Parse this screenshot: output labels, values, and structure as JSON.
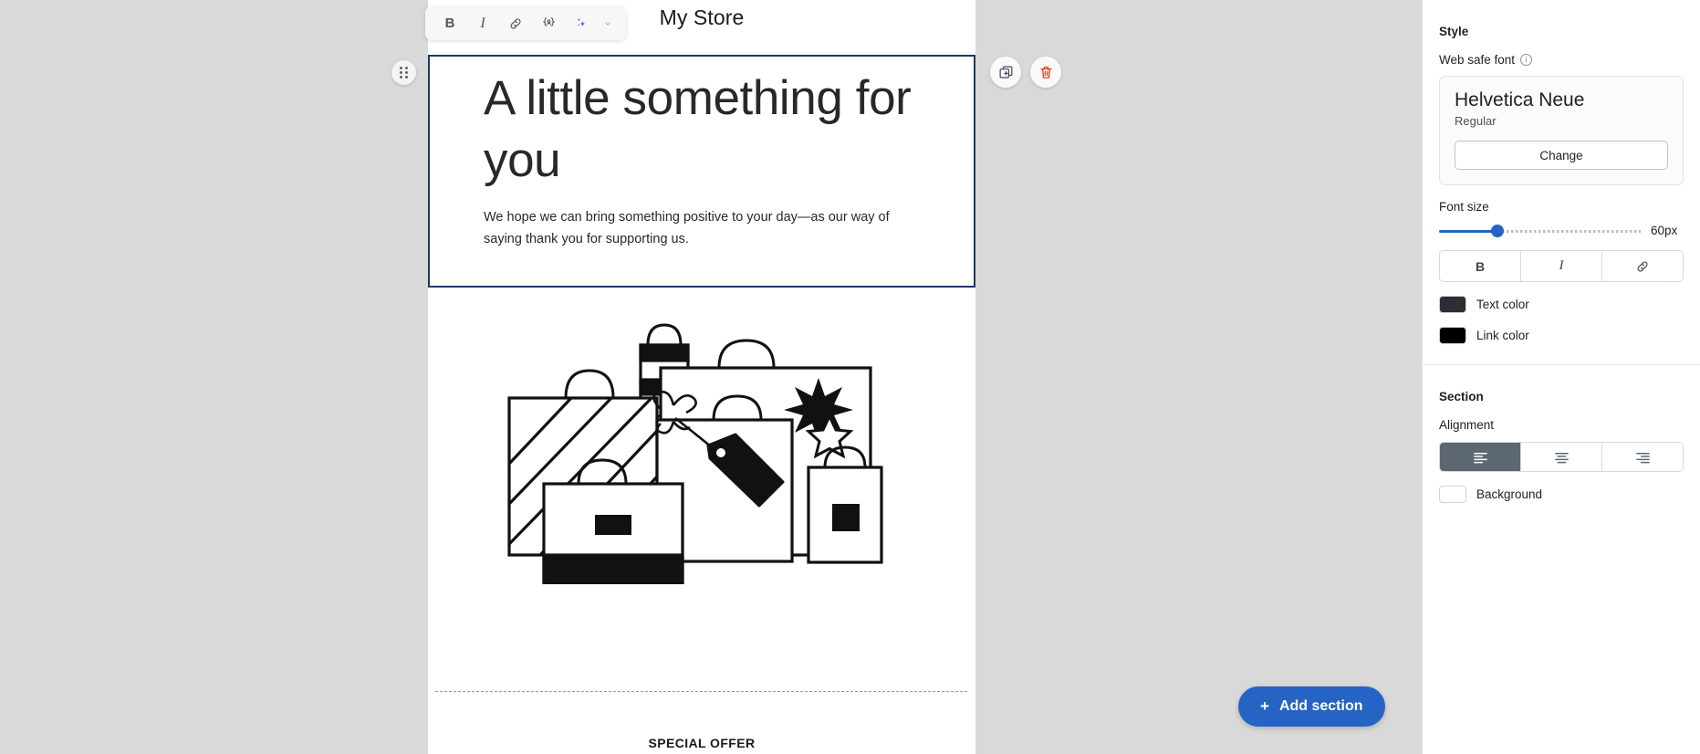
{
  "canvas": {
    "store_title": "My Store",
    "heading": "A little something for you",
    "body": "We hope we can bring something positive to your day—as our way of saying thank you for supporting us.",
    "special_offer": "SPECIAL OFFER",
    "illustration_name": "shopping-bags-illustration",
    "selection_border_color": "#1f3864"
  },
  "format_toolbar": {
    "bold_label": "B",
    "italic_label": "I",
    "link_icon": "link-icon",
    "merge_tag_icon": "merge-tag-icon",
    "ai_icon": "ai-sparkle-icon",
    "chevron_icon": "chevron-down-icon"
  },
  "block_controls": {
    "drag_handle_icon": "drag-handle-icon",
    "duplicate_icon": "duplicate-icon",
    "delete_icon": "delete-trash-icon",
    "delete_color": "#d72c0d"
  },
  "add_section": {
    "plus": "+",
    "label": "Add section",
    "color": "#2563c4"
  },
  "sidebar": {
    "style": {
      "title": "Style",
      "web_safe_font_label": "Web safe font",
      "info_icon": "info-icon",
      "font_name": "Helvetica Neue",
      "font_weight": "Regular",
      "change_label": "Change",
      "font_size_label": "Font size",
      "font_size_value": "60px",
      "bold_label": "B",
      "italic_label": "I",
      "link_icon": "link-icon",
      "text_color_label": "Text color",
      "text_color_value": "#2b2f33",
      "link_color_label": "Link color",
      "link_color_value": "#000000"
    },
    "section": {
      "title": "Section",
      "alignment_label": "Alignment",
      "align_left_icon": "align-left-icon",
      "align_center_icon": "align-center-icon",
      "align_right_icon": "align-right-icon",
      "active_alignment": "left",
      "background_label": "Background",
      "background_value": "#ffffff"
    }
  }
}
